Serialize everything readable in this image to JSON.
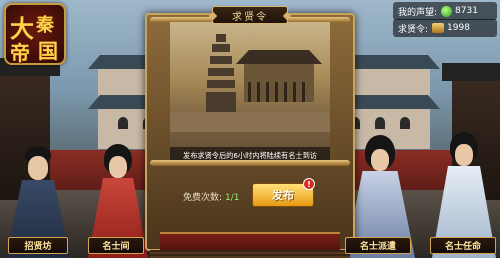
{
  "logo": {
    "chars": [
      "大",
      "秦",
      "帝",
      "国"
    ]
  },
  "resources": {
    "fame_label": "我的声望:",
    "fame_value": "8731",
    "order_label": "求贤令:",
    "order_value": "1998"
  },
  "panel": {
    "title": "求贤令",
    "caption": "发布求贤令后的6小时内将陆续有名士到访",
    "free_label": "免费次数:",
    "free_count": "1/1",
    "publish_label": "发布",
    "badge": "!"
  },
  "nav": {
    "left1": "招贤坊",
    "left2": "名士间",
    "right1": "名士派遣",
    "right2": "名士任命"
  }
}
